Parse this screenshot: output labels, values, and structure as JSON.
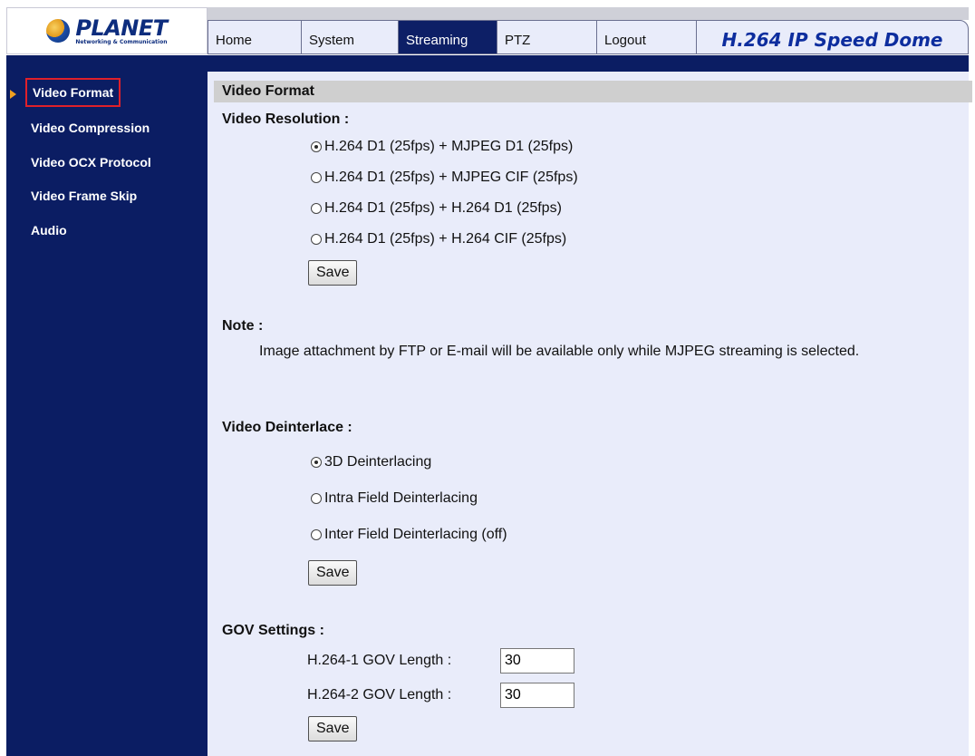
{
  "brand": {
    "name": "PLANET",
    "tagline": "Networking & Communication"
  },
  "nav": {
    "tabs": [
      {
        "label": "Home"
      },
      {
        "label": "System"
      },
      {
        "label": "Streaming"
      },
      {
        "label": "PTZ"
      },
      {
        "label": "Logout"
      }
    ],
    "active": "Streaming",
    "product_title": "H.264 IP Speed Dome"
  },
  "sidebar": {
    "items": [
      {
        "label": "Video Format"
      },
      {
        "label": "Video Compression"
      },
      {
        "label": "Video OCX Protocol"
      },
      {
        "label": "Video Frame Skip"
      },
      {
        "label": "Audio"
      }
    ],
    "selected": "Video Format"
  },
  "content": {
    "section_title": "Video Format",
    "resolution": {
      "heading": "Video Resolution :",
      "options": [
        "H.264 D1 (25fps) + MJPEG D1 (25fps)",
        "H.264 D1 (25fps) + MJPEG CIF (25fps)",
        "H.264 D1 (25fps) + H.264 D1 (25fps)",
        "H.264 D1 (25fps) + H.264 CIF (25fps)"
      ],
      "selected_index": 0,
      "save_label": "Save"
    },
    "note": {
      "heading": "Note :",
      "text": "Image attachment by FTP or E-mail will be available only while MJPEG streaming is selected."
    },
    "deinterlace": {
      "heading": "Video Deinterlace :",
      "options": [
        "3D Deinterlacing",
        "Intra Field Deinterlacing",
        "Inter Field Deinterlacing (off)"
      ],
      "selected_index": 0,
      "save_label": "Save"
    },
    "gov": {
      "heading": "GOV Settings :",
      "rows": [
        {
          "label": "H.264-1 GOV Length :",
          "value": "30"
        },
        {
          "label": "H.264-2 GOV Length :",
          "value": "30"
        }
      ],
      "save_label": "Save"
    }
  },
  "colors": {
    "sidebar_bg": "#0b1d63",
    "content_bg": "#e9ecfa",
    "selection_border": "#e0202a",
    "title_blue": "#0d2d9e"
  }
}
